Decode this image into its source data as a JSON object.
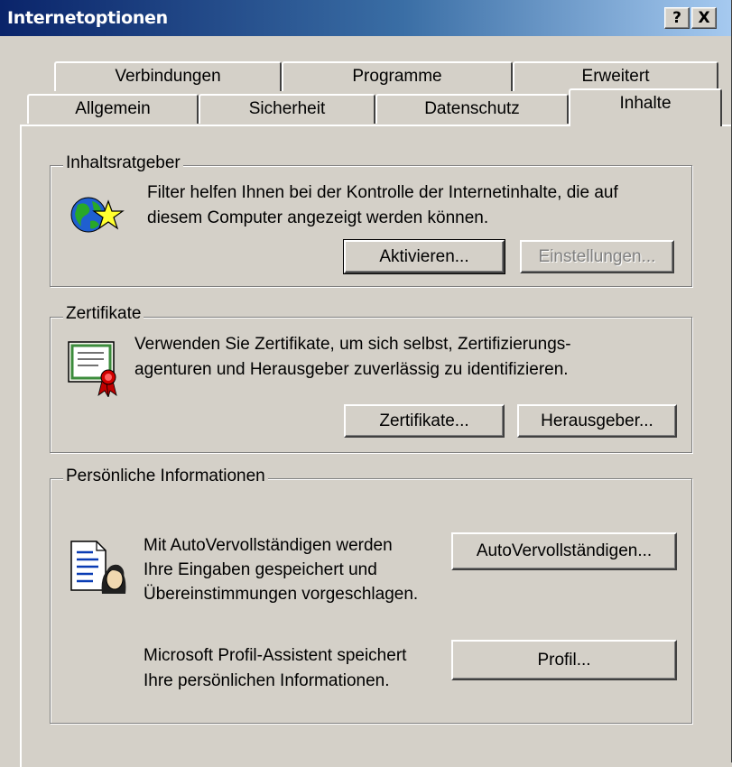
{
  "window": {
    "title": "Internetoptionen",
    "help_label": "?",
    "close_label": "X"
  },
  "tabs": {
    "row_back": [
      "Verbindungen",
      "Programme",
      "Erweitert"
    ],
    "row_front": [
      "Allgemein",
      "Sicherheit",
      "Datenschutz",
      "Inhalte"
    ],
    "active": "Inhalte"
  },
  "content_advisor": {
    "label": "Inhaltsratgeber",
    "text_line1": "Filter helfen Ihnen bei der Kontrolle der Internetinhalte, die auf",
    "text_line2": "diesem Computer angezeigt werden können.",
    "enable_button": "Aktivieren...",
    "settings_button": "Einstellungen..."
  },
  "certificates": {
    "label": "Zertifikate",
    "text_line1": "Verwenden Sie Zertifikate, um sich selbst, Zertifizierungs-",
    "text_line2": "agenturen und Herausgeber zuverlässig zu identifizieren.",
    "certificates_button": "Zertifikate...",
    "publishers_button": "Herausgeber..."
  },
  "personal_info": {
    "label": "Persönliche Informationen",
    "autocomplete_line1": "Mit AutoVervollständigen werden",
    "autocomplete_line2": "Ihre Eingaben gespeichert und",
    "autocomplete_line3": "Übereinstimmungen vorgeschlagen.",
    "autocomplete_button": "AutoVervollständigen...",
    "profile_line1": "Microsoft Profil-Assistent speichert",
    "profile_line2": "Ihre persönlichen Informationen.",
    "profile_button": "Profil..."
  },
  "icons": {
    "content_advisor": "globe-star-icon",
    "certificates": "certificate-icon",
    "autocomplete": "person-document-icon"
  }
}
